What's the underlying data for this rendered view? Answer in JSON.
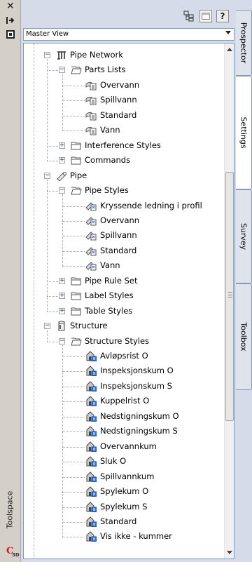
{
  "window": {
    "title": "Toolspace",
    "icons": {
      "close": "close-icon",
      "autohide": "autohide-icon",
      "properties": "properties-icon",
      "app": "civil3d-app-icon"
    }
  },
  "toolbar": {
    "buttons": [
      {
        "name": "toggle-view-button",
        "icon": "tree-view-icon"
      },
      {
        "name": "item-view-button",
        "icon": "window-icon"
      },
      {
        "name": "help-button",
        "label": "?"
      }
    ]
  },
  "view_selector": {
    "value": "Master View"
  },
  "tree": {
    "items": [
      {
        "label": "Pipe Network",
        "level": 0,
        "expander": "−",
        "icon": "pipe-network-icon"
      },
      {
        "label": "Parts Lists",
        "level": 1,
        "expander": "−",
        "icon": "folder-open-icon"
      },
      {
        "label": "Overvann",
        "level": 2,
        "icon": "parts-list-icon"
      },
      {
        "label": "Spillvann",
        "level": 2,
        "icon": "parts-list-icon"
      },
      {
        "label": "Standard",
        "level": 2,
        "icon": "parts-list-icon"
      },
      {
        "label": "Vann",
        "level": 2,
        "icon": "parts-list-icon"
      },
      {
        "label": "Interference Styles",
        "level": 1,
        "expander": "+",
        "icon": "folder-icon"
      },
      {
        "label": "Commands",
        "level": 1,
        "expander": "+",
        "icon": "folder-icon"
      },
      {
        "label": "Pipe",
        "level": 0,
        "expander": "−",
        "icon": "pipe-icon"
      },
      {
        "label": "Pipe Styles",
        "level": 1,
        "expander": "−",
        "icon": "folder-open-icon"
      },
      {
        "label": "Kryssende ledning i profil",
        "level": 2,
        "icon": "pipe-style-icon"
      },
      {
        "label": "Overvann",
        "level": 2,
        "icon": "pipe-style-icon"
      },
      {
        "label": "Spillvann",
        "level": 2,
        "icon": "pipe-style-icon"
      },
      {
        "label": "Standard",
        "level": 2,
        "icon": "pipe-style-icon"
      },
      {
        "label": "Vann",
        "level": 2,
        "icon": "pipe-style-icon"
      },
      {
        "label": "Pipe Rule Set",
        "level": 1,
        "expander": "+",
        "icon": "folder-icon"
      },
      {
        "label": "Label Styles",
        "level": 1,
        "expander": "+",
        "icon": "folder-icon"
      },
      {
        "label": "Table Styles",
        "level": 1,
        "expander": "+",
        "icon": "folder-icon"
      },
      {
        "label": "Structure",
        "level": 0,
        "expander": "−",
        "icon": "structure-icon"
      },
      {
        "label": "Structure Styles",
        "level": 1,
        "expander": "−",
        "icon": "folder-open-icon"
      },
      {
        "label": "Avløpsrist O",
        "level": 2,
        "icon": "structure-style-icon"
      },
      {
        "label": "Inspeksjonskum O",
        "level": 2,
        "icon": "structure-style-icon"
      },
      {
        "label": "Inspeksjonskum S",
        "level": 2,
        "icon": "structure-style-icon"
      },
      {
        "label": "Kuppelrist O",
        "level": 2,
        "icon": "structure-style-icon"
      },
      {
        "label": "Nedstigningskum O",
        "level": 2,
        "icon": "structure-style-icon"
      },
      {
        "label": "Nedstigningskum S",
        "level": 2,
        "icon": "structure-style-icon"
      },
      {
        "label": "Overvannkum",
        "level": 2,
        "icon": "structure-style-icon"
      },
      {
        "label": "Sluk O",
        "level": 2,
        "icon": "structure-style-icon"
      },
      {
        "label": "Spillvannkum",
        "level": 2,
        "icon": "structure-style-icon"
      },
      {
        "label": "Spylekum O",
        "level": 2,
        "icon": "structure-style-icon"
      },
      {
        "label": "Spylekum S",
        "level": 2,
        "icon": "structure-style-icon"
      },
      {
        "label": "Standard",
        "level": 2,
        "icon": "structure-style-icon"
      },
      {
        "label": "Vis ikke - kummer",
        "level": 2,
        "icon": "structure-style-icon"
      }
    ]
  },
  "tabs": [
    {
      "label": "Prospector"
    },
    {
      "label": "Settings",
      "active": true
    },
    {
      "label": "Survey"
    },
    {
      "label": "Toolbox"
    }
  ],
  "colors": {
    "accent": "#cc1a1a",
    "panel": "#d6dbe9",
    "tree_bg": "#ffffff"
  }
}
